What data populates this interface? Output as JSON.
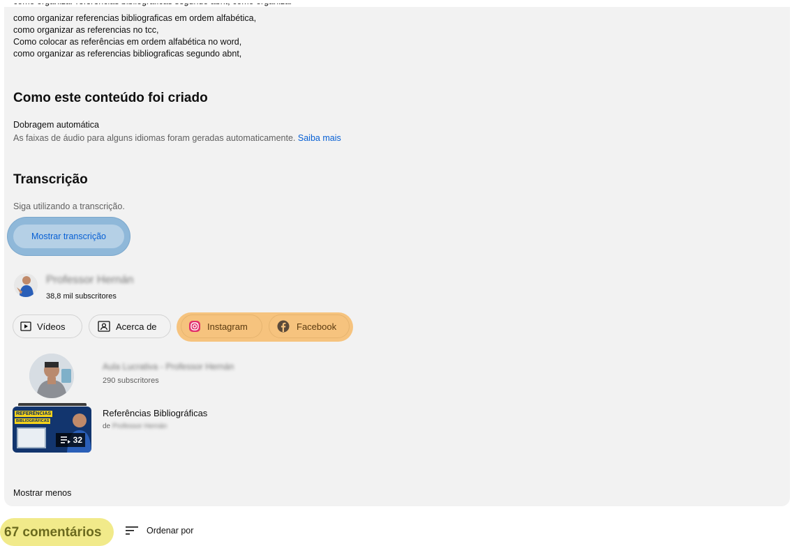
{
  "description": {
    "lines": [
      "como organizar referencias bibliograficas em ordem alfabética,",
      "como organizar as referencias no tcc,",
      "Como colocar as referências em ordem alfabética no word,",
      "como organizar as referencias bibliograficas segundo abnt,"
    ]
  },
  "content_section": {
    "title": "Como este conteúdo foi criado",
    "subtitle": "Dobragem automática",
    "text": "As faixas de áudio para alguns idiomas foram geradas automaticamente.",
    "link": "Saiba mais"
  },
  "transcript": {
    "title": "Transcrição",
    "text": "Siga utilizando a transcrição.",
    "button": "Mostrar transcrição"
  },
  "channel": {
    "name": "Professor Hernán",
    "subscribers": "38,8 mil subscritores",
    "buttons": {
      "videos": "Vídeos",
      "about": "Acerca de",
      "instagram": "Instagram",
      "facebook": "Facebook"
    }
  },
  "featured_channel": {
    "name": "Aula Lucrativa - Professor Hernán",
    "subscribers": "290 subscritores"
  },
  "playlist": {
    "title": "Referências Bibliográficas",
    "by_prefix": "de",
    "by_name": "Professor Hernán",
    "count": "32",
    "thumb_line1": "REFERÊNCIAS",
    "thumb_line2": "BIBLIOGRÁFICAS"
  },
  "show_less": "Mostrar menos",
  "comments": {
    "count_label": "67 comentários",
    "sort_label": "Ordenar por"
  },
  "colors": {
    "link": "#065fd4",
    "highlight_blue": "#8fb8d9",
    "highlight_orange": "#f6c37e",
    "highlight_yellow": "#f1ea8a"
  }
}
